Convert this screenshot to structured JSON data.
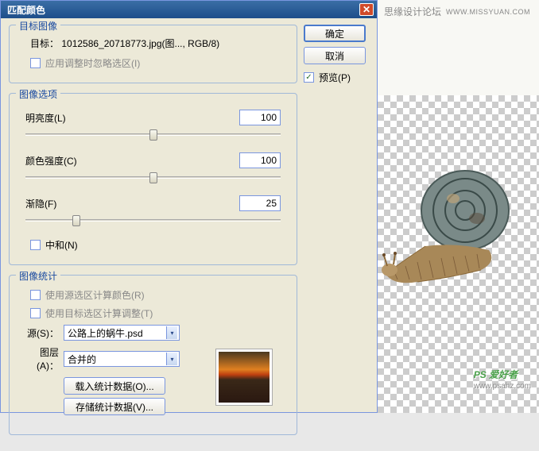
{
  "titlebar": {
    "title": "匹配颜色"
  },
  "buttons": {
    "ok": "确定",
    "cancel": "取消",
    "preview": "预览(P)"
  },
  "target_image": {
    "legend": "目标图像",
    "target_label": "目标：",
    "target_value": "1012586_20718773.jpg(图..., RGB/8)",
    "ignore_selection": "应用调整时忽略选区(I)"
  },
  "image_options": {
    "legend": "图像选项",
    "luminance": {
      "label": "明亮度(L)",
      "value": "100"
    },
    "color_intensity": {
      "label": "颜色强度(C)",
      "value": "100"
    },
    "fade": {
      "label": "渐隐(F)",
      "value": "25"
    },
    "neutralize": "中和(N)"
  },
  "image_stats": {
    "legend": "图像统计",
    "use_source_selection": "使用源选区计算颜色(R)",
    "use_target_selection": "使用目标选区计算调整(T)",
    "source_label": "源(S)：",
    "source_value": "公路上的蜗牛.psd",
    "layer_label": "图层(A)：",
    "layer_value": "合并的",
    "load_stats": "载入统计数据(O)...",
    "save_stats": "存储统计数据(V)..."
  },
  "watermark": {
    "top_text": "思缘设计论坛",
    "top_url": "WWW.MISSYUAN.COM",
    "bottom_brand": "PS 爱好者",
    "bottom_url": "www.psahz.com"
  }
}
